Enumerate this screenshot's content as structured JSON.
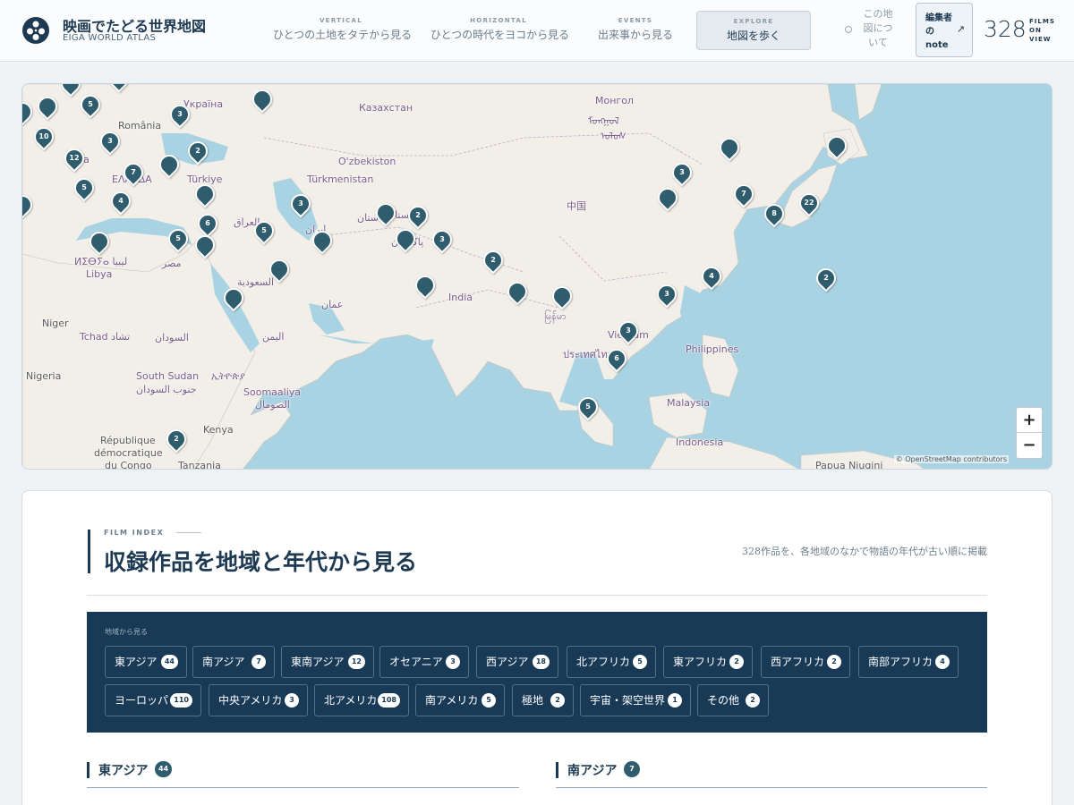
{
  "header": {
    "title": "映画でたどる世界地図",
    "subtitle": "EIGA WORLD ATLAS",
    "nav": [
      {
        "kicker": "VERTICAL",
        "label": "ひとつの土地をタテから見る"
      },
      {
        "kicker": "HORIZONTAL",
        "label": "ひとつの時代をヨコから見る"
      },
      {
        "kicker": "EVENTS",
        "label": "出来事から見る"
      },
      {
        "kicker": "EXPLORE",
        "label": "地図を歩く"
      }
    ],
    "about_label": "この地図について",
    "note_label": "編集者のnote",
    "note_arrow": "↗",
    "film_count": "328",
    "film_count_label": "FILMS ON VIEW"
  },
  "map": {
    "attribution": "© OpenStreetMap contributors",
    "zoom_in": "+",
    "zoom_out": "−",
    "places": [
      "Україна",
      "România",
      "Казахстан",
      "Монгол",
      "ᠮᠣᠩᠭᠣᠯ",
      "ᠤᠯᠤᠰ",
      "O'zbekiston",
      "Türkiye",
      "Türkmenistan",
      "ΕΛΛΆΔΑ",
      "lia",
      "中国",
      "ستان",
      "افغانستان",
      "العراق",
      "ایران",
      "پاکستان",
      "ⵍⵉⴱⵢⴰ ليبيا",
      "Libya",
      "مصر",
      "السعودية",
      "India",
      "عمان",
      "Niger",
      "Tchad تشاد",
      "السودان",
      "اليمن",
      "မြန်မာ",
      "Vietnam",
      "Philippines",
      "ประเทศไทย",
      "Nigeria",
      "South Sudan",
      "جنوب السودان",
      "ኢትዮጵያ",
      "Soomaaliya",
      "الصومال",
      "Malaysia",
      "Kenya",
      "République",
      "démocratique",
      "du Congo",
      "Tanzania",
      "Indonesia",
      "Papua Niugini"
    ],
    "markers": [
      "",
      "",
      "",
      "5",
      "",
      "3",
      "",
      "10",
      "3",
      "2",
      "12",
      "7",
      "",
      "5",
      "",
      "4",
      "",
      "3",
      "6",
      "",
      "5",
      "5",
      "",
      "",
      "2",
      "",
      "3",
      "2",
      "",
      "",
      "",
      "",
      "3",
      "",
      "7",
      "8",
      "22",
      "4",
      "3",
      "2",
      "3",
      "6",
      "5"
    ]
  },
  "index": {
    "kicker": "FILM INDEX",
    "title": "収録作品を地域と年代から見る",
    "description": "328作品を、各地域のなかで物語の年代が古い順に掲載",
    "regions_heading": "地域から見る",
    "regions": [
      {
        "name": "東アジア",
        "count": "44"
      },
      {
        "name": "南アジア",
        "count": "7"
      },
      {
        "name": "東南アジア",
        "count": "12"
      },
      {
        "name": "オセアニア",
        "count": "3"
      },
      {
        "name": "西アジア",
        "count": "18"
      },
      {
        "name": "北アフリカ",
        "count": "5"
      },
      {
        "name": "東アフリカ",
        "count": "2"
      },
      {
        "name": "西アフリカ",
        "count": "2"
      },
      {
        "name": "南部アフリカ",
        "count": "4"
      },
      {
        "name": "ヨーロッパ",
        "count": "110"
      },
      {
        "name": "中央アメリカ",
        "count": "3"
      },
      {
        "name": "北アメリカ",
        "count": "108"
      },
      {
        "name": "南アメリカ",
        "count": "5"
      },
      {
        "name": "極地",
        "count": "2"
      },
      {
        "name": "宇宙・架空世界",
        "count": "1"
      },
      {
        "name": "その他",
        "count": "2"
      }
    ],
    "sections": [
      {
        "title": "東アジア",
        "count": "44"
      },
      {
        "title": "南アジア",
        "count": "7"
      }
    ]
  },
  "colors": {
    "navy": "#183a56",
    "marker": "#2f5d6e",
    "sea": "#a9d3e3",
    "land": "#f2efe9"
  }
}
